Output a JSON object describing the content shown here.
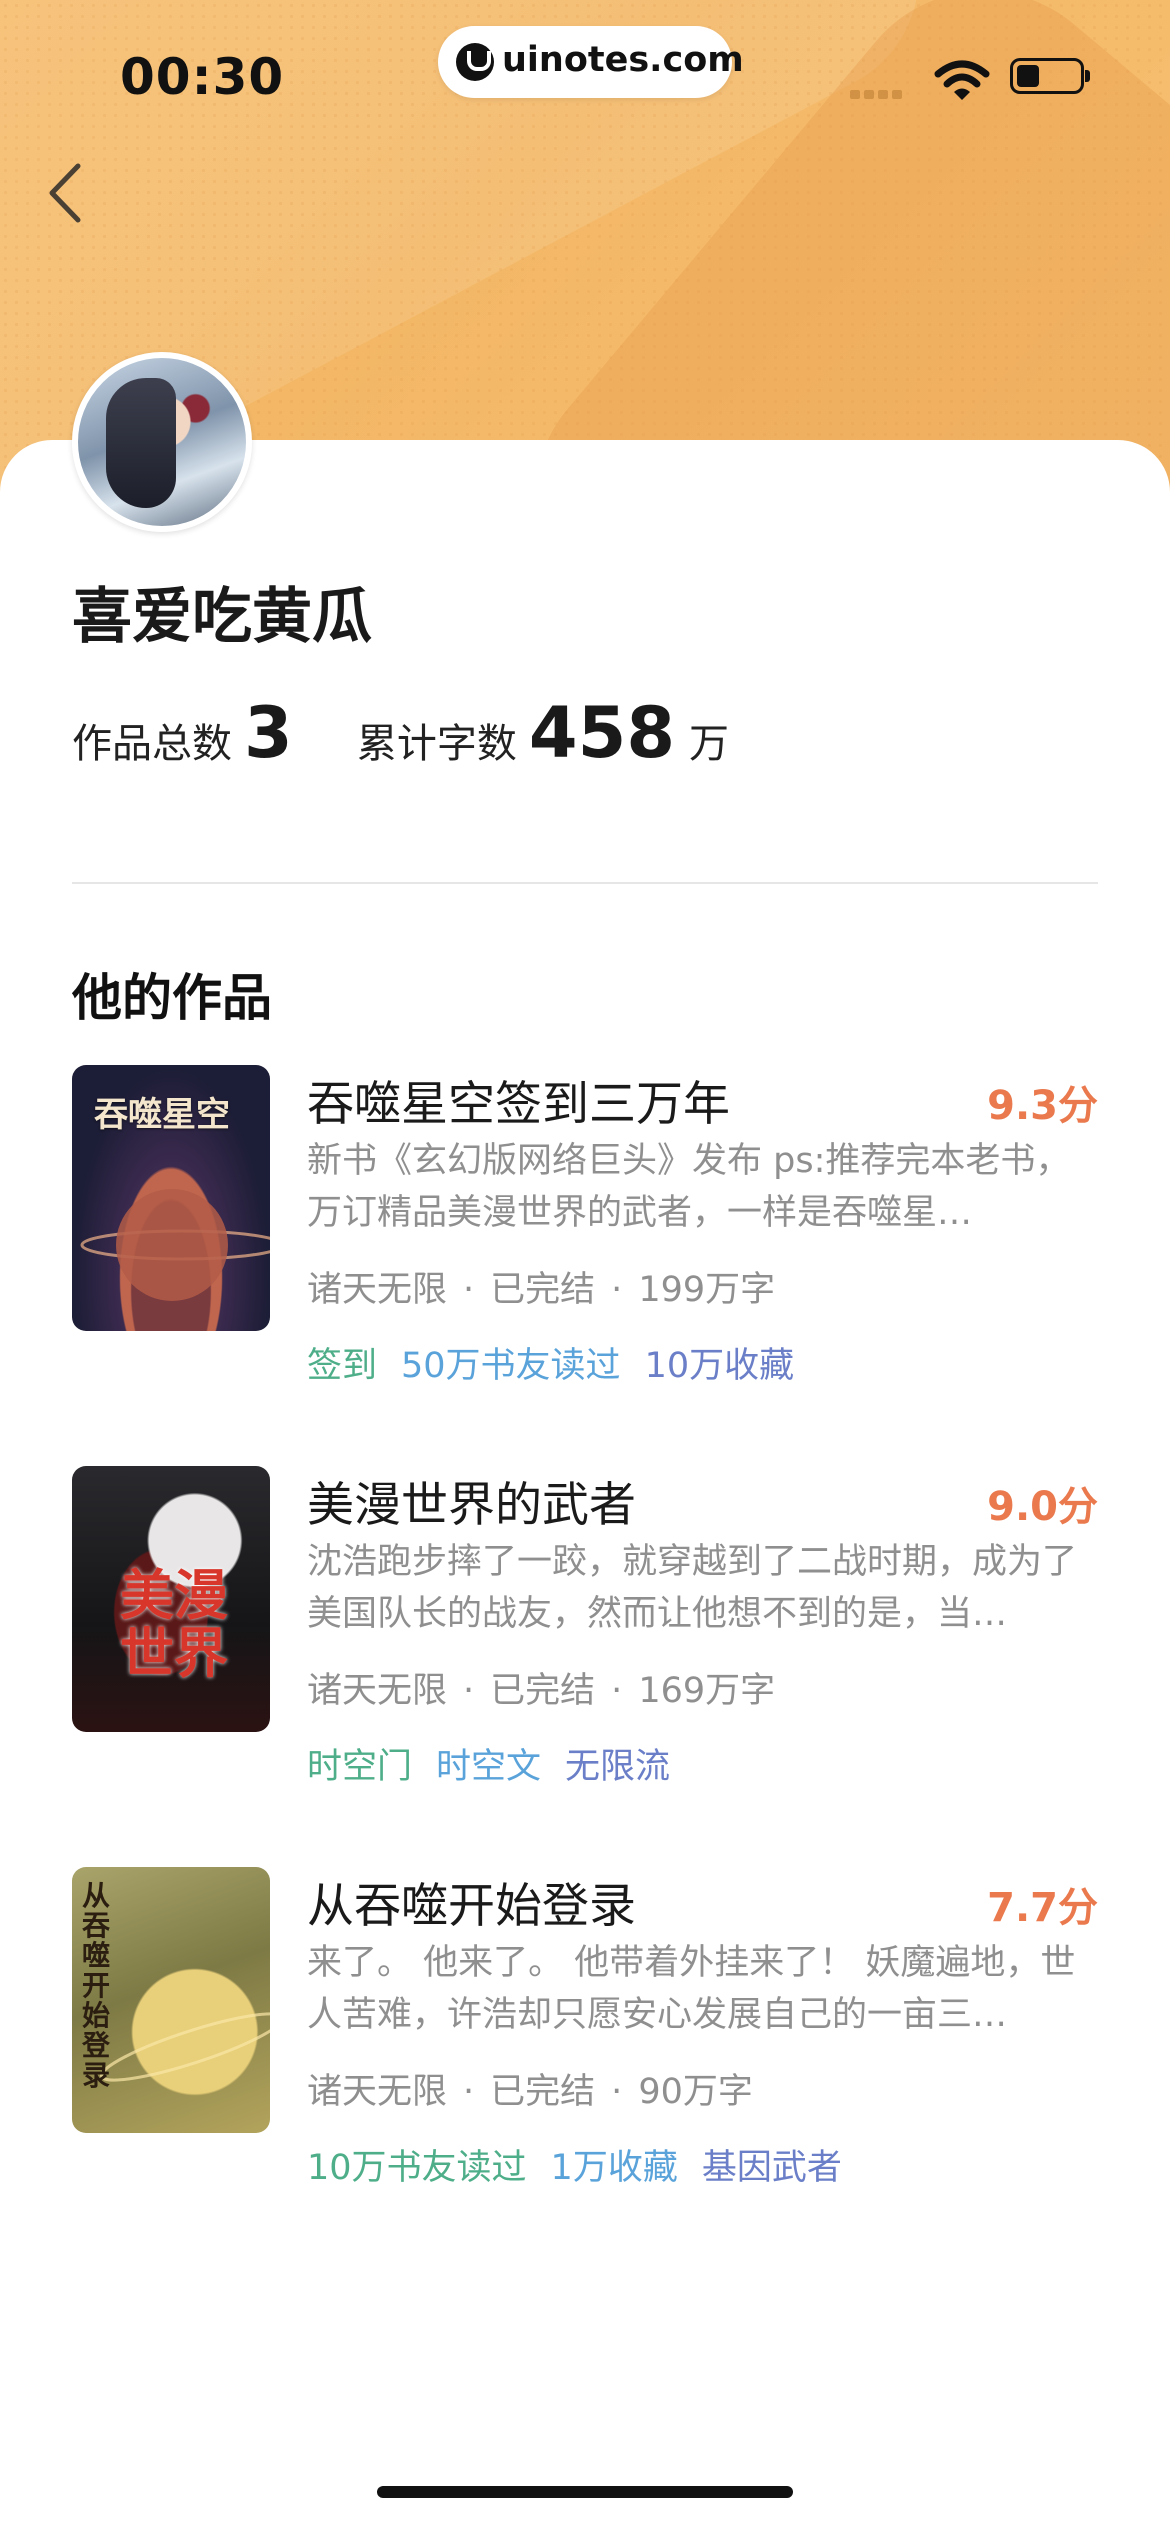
{
  "status_bar": {
    "time": "00:30",
    "site_pill": "uinotes.com"
  },
  "profile": {
    "name": "喜爱吃黄瓜",
    "works_label": "作品总数",
    "works_count": "3",
    "words_label": "累计字数",
    "words_count": "458",
    "words_unit": "万"
  },
  "section_title": "他的作品",
  "works": [
    {
      "title": "吞噬星空签到三万年",
      "score": "9.3分",
      "desc": "新书《玄幻版网络巨头》发布 ps:推荐完本老书，万订精品美漫世界的武者，一样是吞噬星…",
      "category": "诸天无限",
      "status": "已完结",
      "words": "199万字",
      "tags": [
        "签到",
        "50万书友读过",
        "10万收藏"
      ],
      "cover_text": "吞噬星空"
    },
    {
      "title": "美漫世界的武者",
      "score": "9.0分",
      "desc": "沈浩跑步摔了一跤，就穿越到了二战时期，成为了美国队长的战友，然而让他想不到的是，当…",
      "category": "诸天无限",
      "status": "已完结",
      "words": "169万字",
      "tags": [
        "时空门",
        "时空文",
        "无限流"
      ],
      "cover_text": "美漫世界"
    },
    {
      "title": "从吞噬开始登录",
      "score": "7.7分",
      "desc": "来了。 他来了。 他带着外挂来了！ 妖魔遍地，世人苦难，许浩却只愿安心发展自己的一亩三…",
      "category": "诸天无限",
      "status": "已完结",
      "words": "90万字",
      "tags": [
        "10万书友读过",
        "1万收藏",
        "基因武者"
      ],
      "cover_text": "从吞噬开始登录"
    }
  ],
  "colors": {
    "score": "#ea7a4e",
    "tag_green": "#4fae8a",
    "tag_blue": "#5aa3da",
    "tag_indigo": "#6a7fc8",
    "header": "#f3b766"
  }
}
